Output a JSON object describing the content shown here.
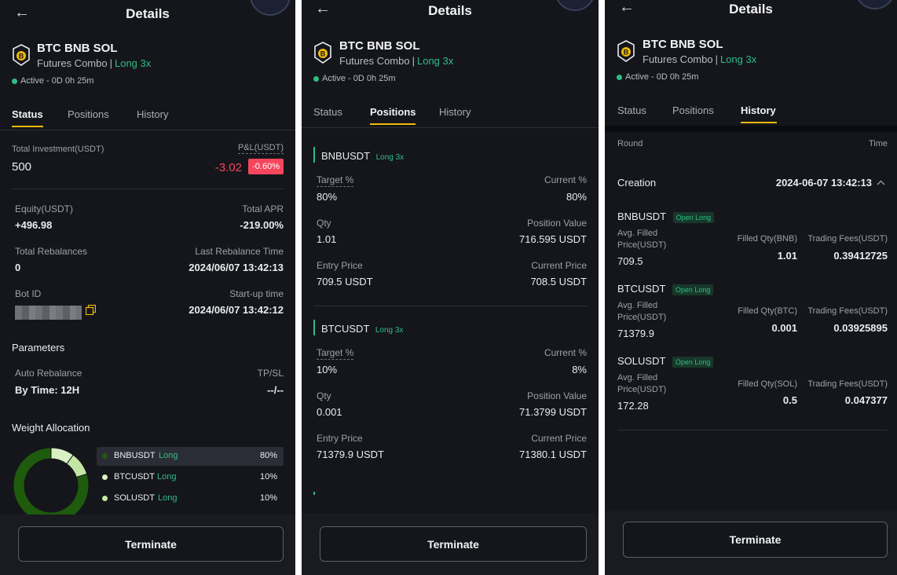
{
  "common": {
    "title": "Details",
    "bot_name": "BTC BNB SOL",
    "bot_type": "Futures Combo",
    "bot_sep": "|",
    "leverage": "Long 3x",
    "status": "Active - 0D 0h 25m",
    "tabs": [
      "Status",
      "Positions",
      "History"
    ],
    "terminate_label": "Terminate",
    "icons": {
      "back": "back-arrow-icon",
      "coin": "bitcoin-shield-icon",
      "copy": "copy-icon",
      "chevron": "chevron-up-icon"
    },
    "colors": {
      "accent": "#f0b90b",
      "green": "#2ebd85",
      "red": "#f6465d",
      "bg": "#15161b"
    }
  },
  "status_panel": {
    "total_investment_label": "Total Investment(USDT)",
    "total_investment": "500",
    "pnl_label": "P&L(USDT)",
    "pnl_value": "-3.02",
    "pnl_percent": "-0.60%",
    "equity_label": "Equity(USDT)",
    "equity": "+496.98",
    "apr_label": "Total APR",
    "apr": "-219.00%",
    "rebalances_label": "Total Rebalances",
    "rebalances": "0",
    "last_rebalance_label": "Last Rebalance Time",
    "last_rebalance": "2024/06/07 13:42:13",
    "bot_id_label": "Bot ID",
    "startup_label": "Start-up time",
    "startup": "2024/06/07 13:42:12",
    "parameters_title": "Parameters",
    "auto_rebalance_label": "Auto Rebalance",
    "auto_rebalance": "By Time: 12H",
    "tpsl_label": "TP/SL",
    "tpsl": "--/--",
    "weight_title": "Weight Allocation",
    "allocations": [
      {
        "symbol": "BNBUSDT",
        "side": "Long",
        "pct": "80%",
        "color": "#1e5b0c",
        "fraction": 0.8
      },
      {
        "symbol": "BTCUSDT",
        "side": "Long",
        "pct": "10%",
        "color": "#d8f0c2",
        "fraction": 0.1
      },
      {
        "symbol": "SOLUSDT",
        "side": "Long",
        "pct": "10%",
        "color": "#c4e6a4",
        "fraction": 0.1
      }
    ]
  },
  "positions_panel": {
    "positions": [
      {
        "symbol": "BNBUSDT",
        "tag": "Long 3x",
        "target_label": "Target %",
        "target": "80%",
        "current_label": "Current %",
        "current": "80%",
        "qty_label": "Qty",
        "qty": "1.01",
        "pos_value_label": "Position Value",
        "pos_value": "716.595 USDT",
        "entry_label": "Entry Price",
        "entry": "709.5 USDT",
        "cur_price_label": "Current Price",
        "cur_price": "708.5 USDT"
      },
      {
        "symbol": "BTCUSDT",
        "tag": "Long 3x",
        "target_label": "Target %",
        "target": "10%",
        "current_label": "Current %",
        "current": "8%",
        "qty_label": "Qty",
        "qty": "0.001",
        "pos_value_label": "Position Value",
        "pos_value": "71.3799 USDT",
        "entry_label": "Entry Price",
        "entry": "71379.9 USDT",
        "cur_price_label": "Current Price",
        "cur_price": "71380.1 USDT"
      }
    ]
  },
  "history_panel": {
    "round_label": "Round",
    "time_label": "Time",
    "creation_label": "Creation",
    "creation_time": "2024-06-07 13:42:13",
    "avg_label_1": "Avg. Filled",
    "avg_label_2": "Price(USDT)",
    "fees_label": "Trading Fees(USDT)",
    "entries": [
      {
        "symbol": "BNBUSDT",
        "pill": "Open Long",
        "avg": "709.5",
        "qty_label": "Filled Qty(BNB)",
        "qty": "1.01",
        "fees": "0.39412725"
      },
      {
        "symbol": "BTCUSDT",
        "pill": "Open Long",
        "avg": "71379.9",
        "qty_label": "Filled Qty(BTC)",
        "qty": "0.001",
        "fees": "0.03925895"
      },
      {
        "symbol": "SOLUSDT",
        "pill": "Open Long",
        "avg": "172.28",
        "qty_label": "Filled Qty(SOL)",
        "qty": "0.5",
        "fees": "0.047377"
      }
    ]
  }
}
